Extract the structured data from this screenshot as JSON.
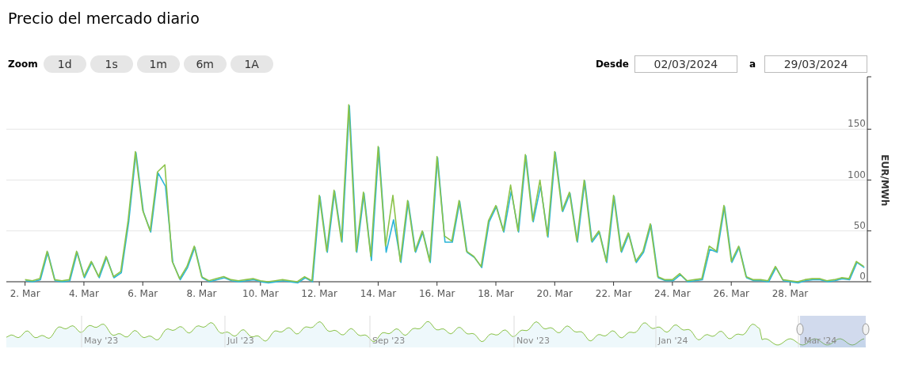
{
  "title": "Precio del mercado diario",
  "zoom": {
    "label": "Zoom",
    "buttons": [
      {
        "label": "1d",
        "selected": false
      },
      {
        "label": "1s",
        "selected": false
      },
      {
        "label": "1m",
        "selected": false
      },
      {
        "label": "6m",
        "selected": false
      },
      {
        "label": "1A",
        "selected": false
      }
    ]
  },
  "range": {
    "from_label": "Desde",
    "from_value": "02/03/2024",
    "to_label": "a",
    "to_value": "29/03/2024"
  },
  "chart": {
    "chart_data": {
      "type": "line",
      "ylabel": "EUR/MWh",
      "ylim": [
        0,
        200
      ],
      "grid": true,
      "yticks": [
        0,
        50,
        100,
        150
      ],
      "categories": [
        "2. Mar",
        null,
        null,
        null,
        null,
        null,
        null,
        null,
        "4. Mar",
        null,
        null,
        null,
        null,
        null,
        null,
        null,
        "6. Mar",
        null,
        null,
        null,
        null,
        null,
        null,
        null,
        "8. Mar",
        null,
        null,
        null,
        null,
        null,
        null,
        null,
        "10. Mar",
        null,
        null,
        null,
        null,
        null,
        null,
        null,
        "12. Mar",
        null,
        null,
        null,
        null,
        null,
        null,
        null,
        "14. Mar",
        null,
        null,
        null,
        null,
        null,
        null,
        null,
        "16. Mar",
        null,
        null,
        null,
        null,
        null,
        null,
        null,
        "18. Mar",
        null,
        null,
        null,
        null,
        null,
        null,
        null,
        "20. Mar",
        null,
        null,
        null,
        null,
        null,
        null,
        null,
        "22. Mar",
        null,
        null,
        null,
        null,
        null,
        null,
        null,
        "24. Mar",
        null,
        null,
        null,
        null,
        null,
        null,
        null,
        "26. Mar",
        null,
        null,
        null,
        null,
        null,
        null,
        null,
        "28. Mar",
        null,
        null,
        null,
        null,
        null,
        null,
        null,
        null,
        null,
        null
      ],
      "series": [
        {
          "color": "#2bb5d8",
          "values": [
            2,
            1,
            3,
            30,
            2,
            1,
            2,
            30,
            5,
            20,
            5,
            25,
            5,
            10,
            60,
            128,
            70,
            50,
            108,
            95,
            20,
            3,
            15,
            35,
            5,
            1,
            3,
            5,
            2,
            1,
            2,
            3,
            1,
            0,
            1,
            2,
            1,
            0,
            5,
            1,
            85,
            30,
            90,
            40,
            174,
            30,
            88,
            22,
            133,
            30,
            62,
            20,
            80,
            30,
            50,
            20,
            123,
            40,
            40,
            80,
            30,
            25,
            15,
            60,
            75,
            50,
            90,
            50,
            125,
            60,
            95,
            45,
            128,
            70,
            88,
            40,
            100,
            40,
            50,
            20,
            85,
            30,
            48,
            20,
            30,
            57,
            5,
            2,
            2,
            8,
            1,
            2,
            3,
            33,
            30,
            75,
            20,
            35,
            5,
            2,
            2,
            1,
            15,
            2,
            1,
            0,
            2,
            3,
            3,
            1,
            2,
            4,
            3,
            20,
            15
          ]
        },
        {
          "color": "#8bc34a",
          "values": [
            2,
            1,
            3,
            30,
            2,
            1,
            2,
            30,
            5,
            20,
            5,
            25,
            5,
            10,
            60,
            128,
            70,
            50,
            108,
            115,
            20,
            3,
            15,
            35,
            5,
            1,
            3,
            5,
            2,
            1,
            2,
            3,
            1,
            0,
            1,
            2,
            1,
            0,
            5,
            1,
            85,
            30,
            90,
            40,
            174,
            30,
            88,
            25,
            133,
            35,
            85,
            20,
            80,
            30,
            50,
            20,
            123,
            45,
            40,
            80,
            30,
            25,
            15,
            60,
            75,
            50,
            95,
            50,
            125,
            60,
            100,
            45,
            128,
            70,
            88,
            40,
            100,
            40,
            50,
            20,
            85,
            30,
            48,
            20,
            30,
            57,
            5,
            2,
            2,
            8,
            1,
            2,
            3,
            35,
            30,
            75,
            20,
            35,
            5,
            2,
            2,
            1,
            15,
            2,
            1,
            0,
            2,
            3,
            3,
            1,
            2,
            4,
            3,
            20,
            15
          ]
        }
      ]
    }
  },
  "navigator": {
    "labels": [
      "May '23",
      "Jul '23",
      "Sep '23",
      "Nov '23",
      "Jan '24",
      "Mar '24"
    ]
  }
}
